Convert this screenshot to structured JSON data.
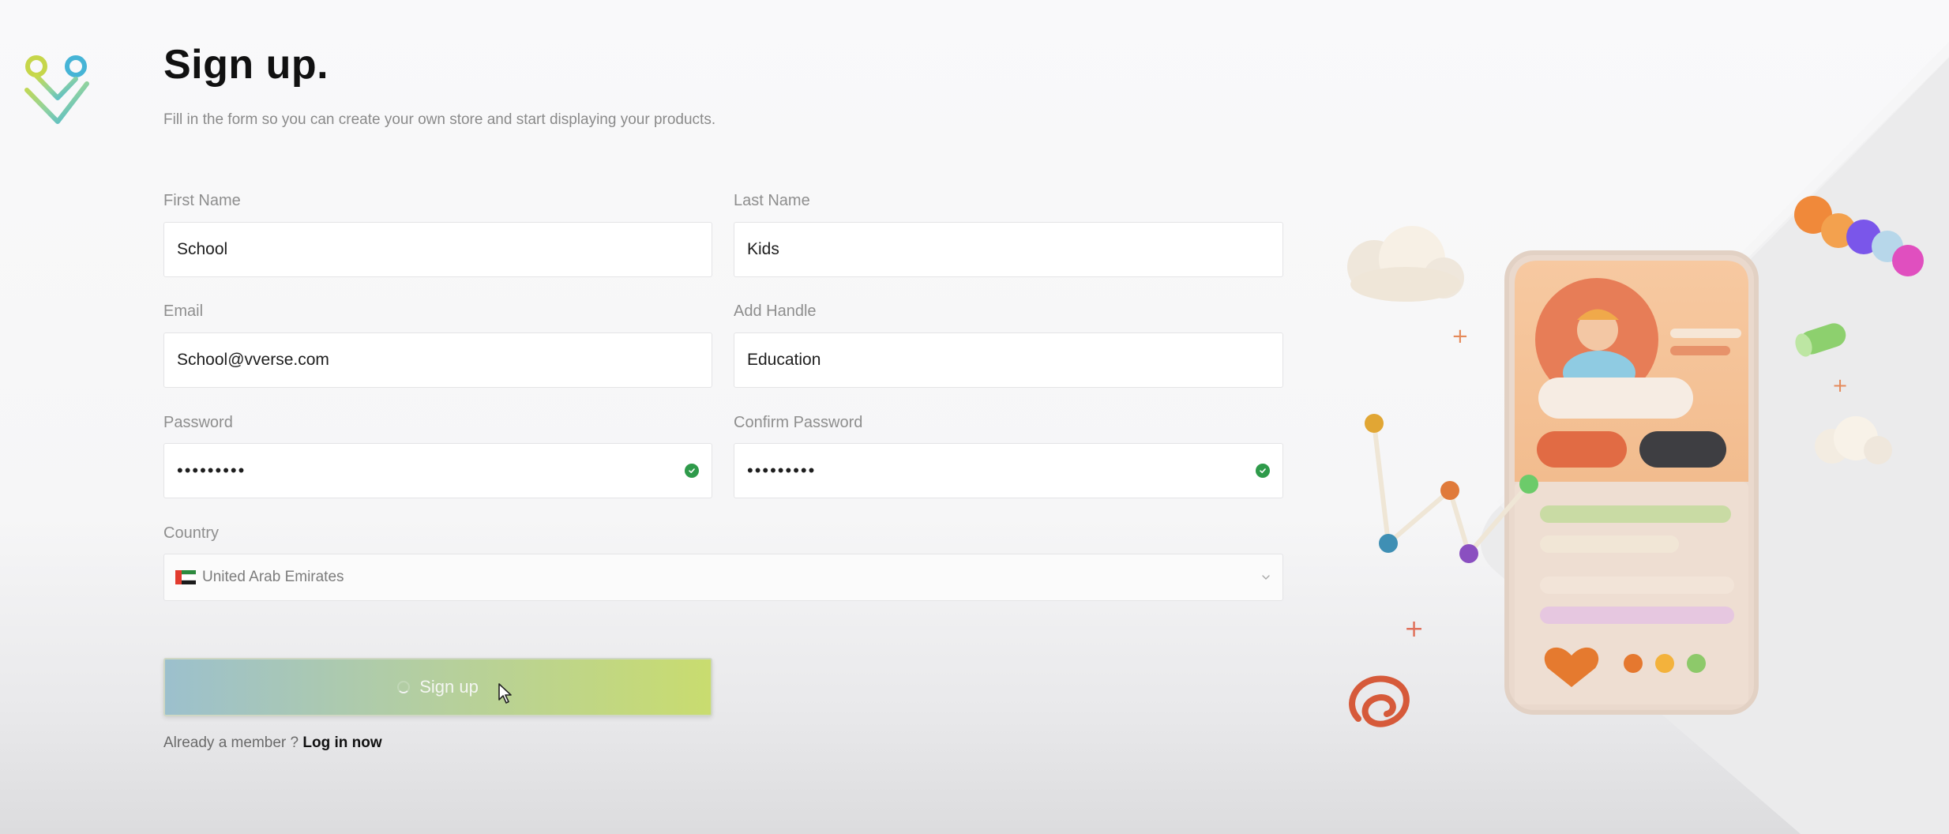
{
  "header": {
    "title": "Sign up.",
    "subtitle": "Fill in the form so you can create your own store and start displaying your products."
  },
  "form": {
    "first_name": {
      "label": "First Name",
      "value": "School"
    },
    "last_name": {
      "label": "Last Name",
      "value": "Kids"
    },
    "email": {
      "label": "Email",
      "value": "School@vverse.com"
    },
    "handle": {
      "label": "Add Handle",
      "value": "Education"
    },
    "password": {
      "label": "Password",
      "value": "•••••••••"
    },
    "confirm_password": {
      "label": "Confirm Password",
      "value": "•••••••••"
    },
    "country": {
      "label": "Country",
      "value": "United Arab Emirates"
    }
  },
  "actions": {
    "signup_label": "Sign up",
    "already_member": "Already a member ?",
    "login_label": "Log in now"
  },
  "icons": {
    "logo": "vverse-logo-icon",
    "valid": "check-circle-icon",
    "dropdown": "chevron-down-icon",
    "loading": "spinner-icon",
    "cursor": "mouse-cursor-icon"
  },
  "colors": {
    "valid": "#2e9a4a",
    "button_start": "#9cc0cd",
    "button_end": "#c9dc6f",
    "title": "#111111"
  }
}
